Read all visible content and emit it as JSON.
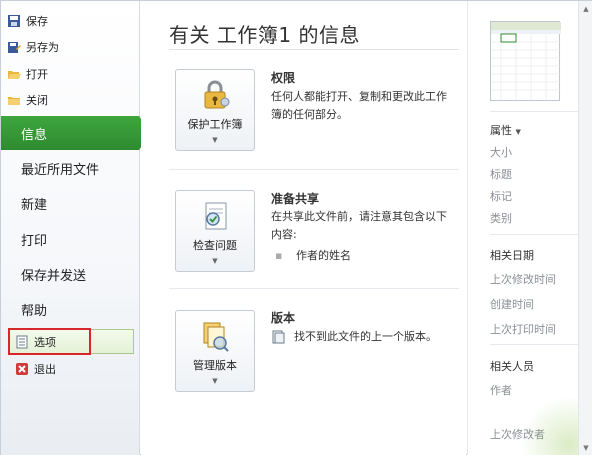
{
  "sidebar": {
    "small_items": [
      {
        "label": "保存",
        "icon": "save-icon"
      },
      {
        "label": "另存为",
        "icon": "save-as-icon"
      },
      {
        "label": "打开",
        "icon": "open-folder-icon"
      },
      {
        "label": "关闭",
        "icon": "close-folder-icon"
      }
    ],
    "big_items": [
      {
        "label": "信息",
        "active": true
      },
      {
        "label": "最近所用文件"
      },
      {
        "label": "新建"
      },
      {
        "label": "打印"
      },
      {
        "label": "保存并发送"
      },
      {
        "label": "帮助"
      }
    ],
    "bottom_items": [
      {
        "label": "选项",
        "icon": "options-icon"
      },
      {
        "label": "退出",
        "icon": "exit-icon"
      }
    ],
    "accent_color": "#2e8b2e"
  },
  "main": {
    "title": "有关 工作簿1 的信息",
    "sections": [
      {
        "button_label": "保护工作簿",
        "icon": "lock-icon",
        "heading": "权限",
        "text": "任何人都能打开、复制和更改此工作簿的任何部分。"
      },
      {
        "button_label": "检查问题",
        "icon": "inspect-document-icon",
        "heading": "准备共享",
        "text": "在共享此文件前，请注意其包含以下内容:",
        "bullet": "作者的姓名"
      },
      {
        "button_label": "管理版本",
        "icon": "manage-versions-icon",
        "heading": "版本",
        "text": "找不到此文件的上一个版本。"
      }
    ]
  },
  "right_panel": {
    "properties_label": "属性",
    "properties": [
      "大小",
      "标题",
      "标记",
      "类别"
    ],
    "dates_label": "相关日期",
    "dates": [
      "上次修改时间",
      "创建时间",
      "上次打印时间"
    ],
    "people_label": "相关人员",
    "people": [
      "作者",
      "上次修改者"
    ]
  }
}
